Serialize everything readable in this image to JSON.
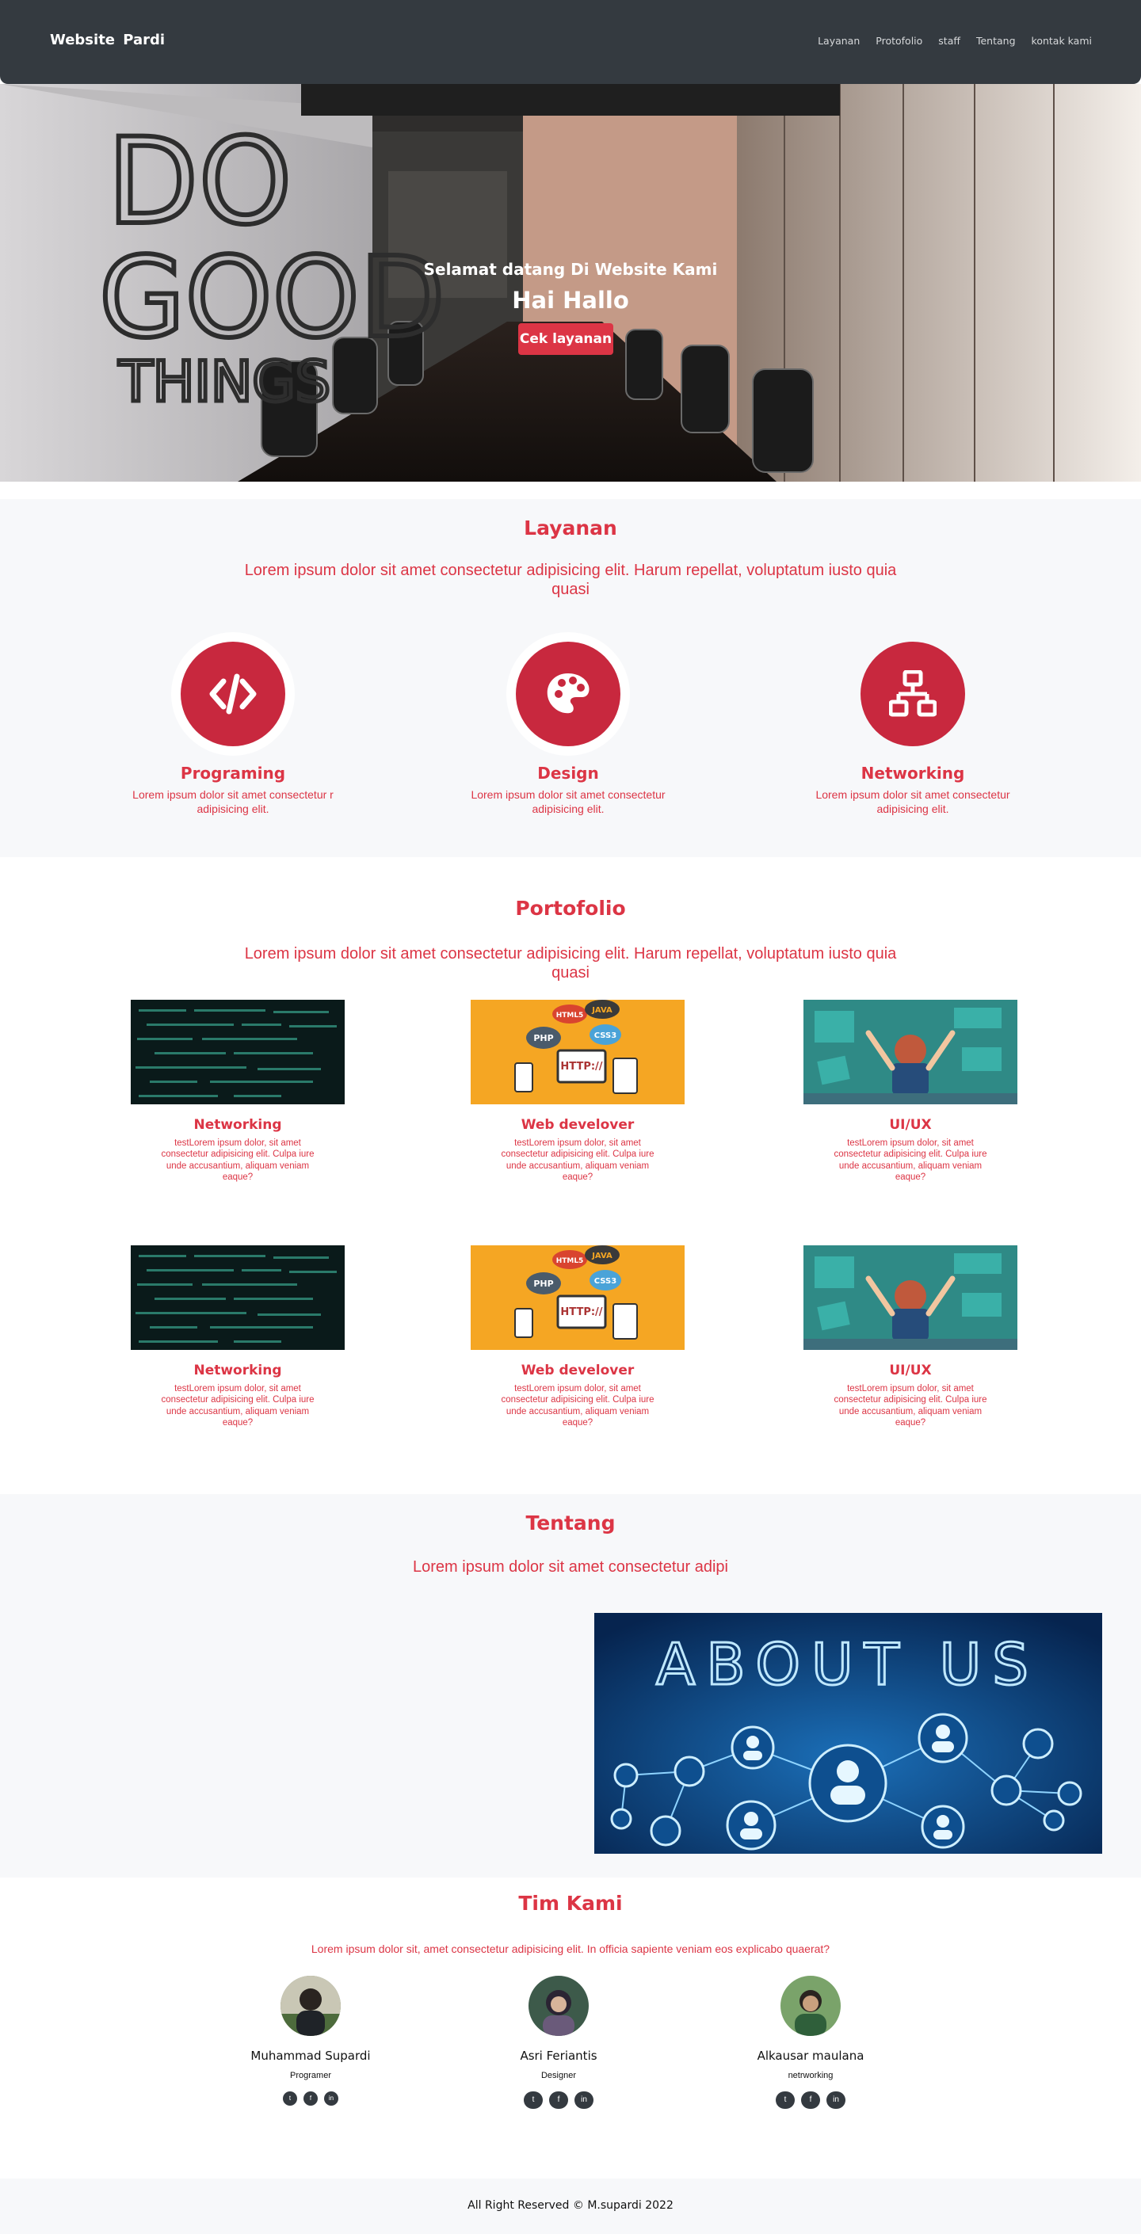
{
  "navbar": {
    "brand": "Website  Pardi",
    "links": [
      "Layanan",
      "Protofolio",
      "staff",
      "Tentang",
      "kontak kami"
    ]
  },
  "hero": {
    "subtitle": "Selamat datang Di Website Kami",
    "title": "Hai Hallo",
    "button": "Cek layanan",
    "wall_text": [
      "DO",
      "GOOD",
      "THINGS"
    ]
  },
  "layanan": {
    "title": "Layanan",
    "lead": "Lorem ipsum dolor sit amet consectetur adipisicing elit. Harum repellat, voluptatum iusto quia quasi",
    "items": [
      {
        "name": "Programing",
        "desc": "Lorem ipsum dolor sit amet consectetur       r adipisicing elit.",
        "icon": "code-icon"
      },
      {
        "name": "Design",
        "desc": "Lorem ipsum dolor sit amet consectetur adipisicing elit.",
        "icon": "palette-icon"
      },
      {
        "name": "Networking",
        "desc": "Lorem ipsum dolor sit amet consectetur adipisicing elit.",
        "icon": "network-icon"
      }
    ]
  },
  "portfolio": {
    "title": "Portofolio",
    "lead": "Lorem ipsum dolor sit amet consectetur adipisicing elit. Harum repellat, voluptatum iusto quia quasi",
    "items": [
      {
        "name": "Networking",
        "desc": "testLorem ipsum dolor, sit amet consectetur adipisicing elit. Culpa iure unde accusantium, aliquam veniam eaque?"
      },
      {
        "name": "Web develover",
        "desc": "testLorem ipsum dolor, sit amet consectetur adipisicing elit. Culpa iure unde accusantium, aliquam veniam eaque?"
      },
      {
        "name": "UI/UX",
        "desc": "testLorem ipsum dolor, sit amet consectetur adipisicing elit. Culpa iure unde accusantium, aliquam veniam eaque?"
      },
      {
        "name": "Networking",
        "desc": "testLorem ipsum dolor, sit amet consectetur adipisicing elit. Culpa iure unde accusantium, aliquam veniam eaque?"
      },
      {
        "name": "Web develover",
        "desc": "testLorem ipsum dolor, sit amet consectetur adipisicing elit. Culpa iure unde accusantium, aliquam veniam eaque?"
      },
      {
        "name": "UI/UX",
        "desc": "testLorem ipsum dolor, sit amet consectetur adipisicing elit. Culpa iure unde accusantium, aliquam veniam eaque?"
      }
    ],
    "webdev_tags": [
      "HTML5",
      "JAVA",
      "PHP",
      "CSS3",
      "HTTP://"
    ]
  },
  "tentang": {
    "title": "Tentang",
    "lead": "Lorem ipsum dolor sit amet consectetur adipi",
    "image_text": "ABOUT US"
  },
  "tim": {
    "title": "Tim Kami",
    "lead": "Lorem ipsum dolor sit, amet consectetur adipisicing elit. In officia sapiente veniam eos explicabo quaerat?",
    "members": [
      {
        "name": "Muhammad Supardi",
        "role": "Programer"
      },
      {
        "name": "Asri Feriantis",
        "role": "Designer"
      },
      {
        "name": "Alkausar maulana",
        "role": "netrworking"
      }
    ]
  },
  "footer": {
    "text": "All Right Reserved © M.supardi 2022"
  },
  "colors": {
    "accent": "#dc3545",
    "navbar": "#343a40",
    "section_bg": "#f7f8fa"
  }
}
